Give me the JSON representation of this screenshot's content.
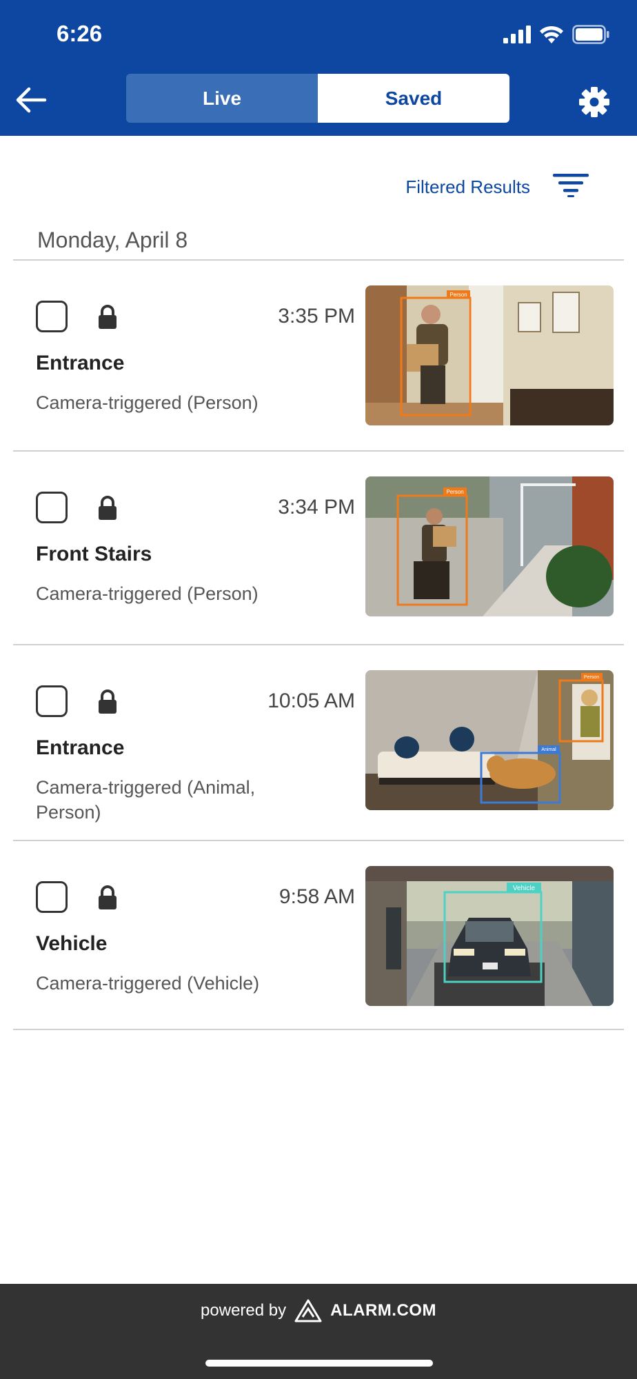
{
  "status_bar": {
    "time": "6:26"
  },
  "header": {
    "tabs": [
      {
        "label": "Live",
        "selected": false
      },
      {
        "label": "Saved",
        "selected": true
      }
    ],
    "colors": {
      "background": "#0d47a1",
      "inactive_tab": "#3a6fb8"
    }
  },
  "filter": {
    "label": "Filtered Results"
  },
  "date_group": "Monday, April 8",
  "events": [
    {
      "time": "3:35 PM",
      "title": "Entrance",
      "subtitle": "Camera-triggered (Person)",
      "labels": [
        "Person"
      ]
    },
    {
      "time": "3:34 PM",
      "title": "Front Stairs",
      "subtitle": "Camera-triggered (Person)",
      "labels": [
        "Person"
      ]
    },
    {
      "time": "10:05 AM",
      "title": "Entrance",
      "subtitle": "Camera-triggered (Animal, Person)",
      "labels": [
        "Person",
        "Animal"
      ]
    },
    {
      "time": "9:58 AM",
      "title": "Vehicle",
      "subtitle": "Camera-triggered (Vehicle)",
      "labels": [
        "Vehicle"
      ]
    }
  ],
  "footer": {
    "powered_by": "powered by",
    "brand": "ALARM.COM"
  }
}
